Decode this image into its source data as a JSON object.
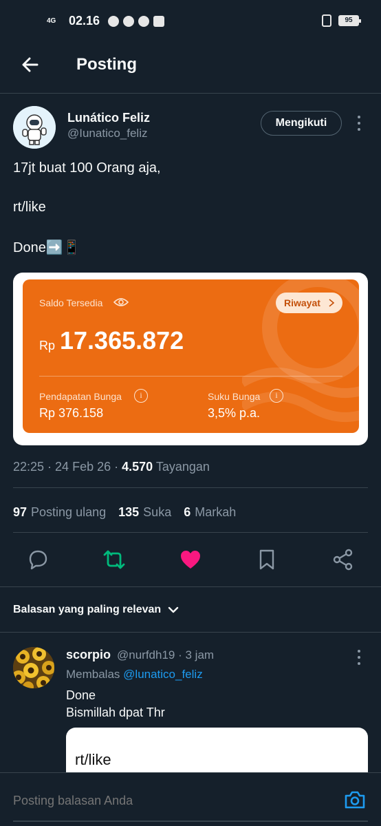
{
  "status_bar": {
    "network": "4G",
    "time": "02.16",
    "battery": "95"
  },
  "header": {
    "title": "Posting"
  },
  "post": {
    "author_name": "Lunático Feliz",
    "author_handle": "@Iunatico_feliz",
    "follow_label": "Mengikuti",
    "lines": [
      "17jt buat 100 Orang  aja,",
      "rt/like",
      "Done➡️📱"
    ],
    "image": {
      "saldo_label": "Saldo Tersedia",
      "riwayat_label": "Riwayat",
      "currency": "Rp",
      "balance": "17.365.872",
      "interest_label": "Pendapatan Bunga",
      "interest_value": "Rp 376.158",
      "rate_label": "Suku Bunga",
      "rate_value": "3,5% p.a.",
      "accent_color": "#ec6c12"
    },
    "time": "22:25",
    "date": "24 Feb 26",
    "views": "4.570",
    "views_label": "Tayangan",
    "reposts": "97",
    "reposts_label": "Posting ulang",
    "likes": "135",
    "likes_label": "Suka",
    "bookmarks": "6",
    "bookmarks_label": "Markah"
  },
  "actions": [
    "reply-icon",
    "repost-icon",
    "like-icon",
    "bookmark-icon",
    "share-icon"
  ],
  "replies": {
    "sort_label": "Balasan yang paling relevan",
    "items": [
      {
        "name": "scorpio",
        "handle": "@nurfdh19",
        "time": "3 jam",
        "replying_prefix": "Membalas",
        "replying_to": "@lunatico_feliz",
        "line1": "Done",
        "line2": "Bismillah dpat Thr",
        "card_text": "rt/like"
      }
    ]
  },
  "compose": {
    "placeholder": "Posting balasan Anda"
  }
}
